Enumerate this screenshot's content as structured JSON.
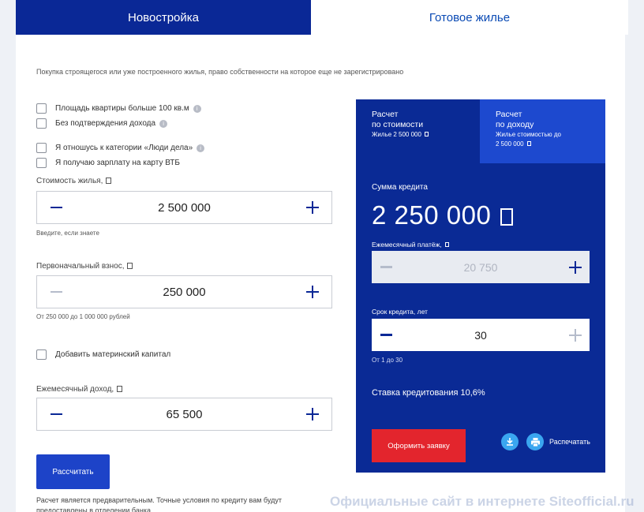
{
  "tabs": {
    "new_building": "Новостройка",
    "ready_housing": "Готовое жилье"
  },
  "intro": "Покупка строящегося или уже построенного жилья, право собственности на которое еще не зарегистрировано",
  "checkboxes": {
    "area_over_100": "Площадь квартиры больше 100 кв.м",
    "no_income_proof": "Без подтверждения дохода",
    "business_people": "Я отношусь к категории «Люди дела»",
    "vtb_salary": "Я получаю зарплату на карту ВТБ",
    "maternity_capital": "Добавить материнский капитал"
  },
  "info_glyph": "i",
  "price": {
    "label": "Стоимость жилья,",
    "value": "2 500 000",
    "hint": "Введите, если знаете"
  },
  "down_payment": {
    "label": "Первоначальный взнос,",
    "value": "250 000",
    "hint": "От 250 000 до 1 000 000 рублей"
  },
  "income": {
    "label": "Ежемесячный доход,",
    "value": "65 500"
  },
  "calculate_button": "Рассчитать",
  "disclaimer": "Расчет является предварительным. Точные условия по кредиту вам будут предоставлены в отделении банка.",
  "panel": {
    "tab_cost": {
      "line1": "Расчет",
      "line2": "по стоимости",
      "sub": "Жилье 2 500 000"
    },
    "tab_income": {
      "line1": "Расчет",
      "line2": "по доходу",
      "sub1": "Жилье стоимостью до",
      "sub2": "2 500 000"
    },
    "loan_sum_label": "Сумма кредита",
    "loan_sum": "2 250 000",
    "monthly_payment_label": "Ежемесячный платёж,",
    "monthly_payment": "20 750",
    "term_label": "Срок кредита, лет",
    "term": "30",
    "term_hint": "От 1 до 30",
    "rate": "Ставка кредитования 10,6%",
    "apply_button": "Оформить заявку",
    "print_label": "Распечатать"
  },
  "watermark": "Официальные сайт в интернете Siteofficial.ru",
  "icons": {
    "download": "download-icon",
    "print": "printer-icon"
  },
  "colors": {
    "brand_blue": "#0a2896",
    "panel_blue": "#0a2a95",
    "active_tab_blue": "#1d49cf",
    "button_blue": "#1d43c8",
    "apply_red": "#e3252d",
    "icon_cyan": "#3aa6f0"
  }
}
